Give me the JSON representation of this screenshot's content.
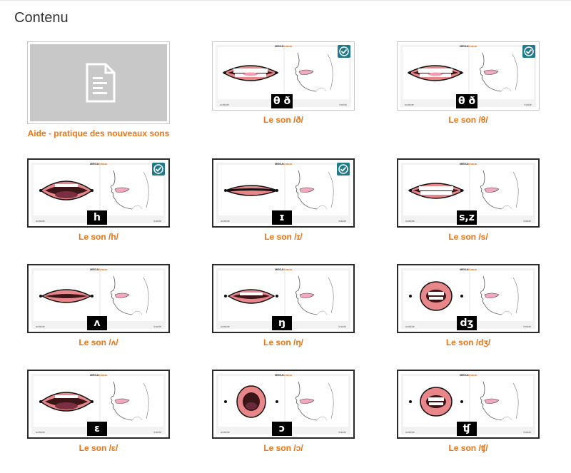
{
  "page": {
    "heading": "Contenu"
  },
  "brand": {
    "left": "MEGA",
    "right": "lingua"
  },
  "footer": {
    "outside": "outside",
    "inside": "inside"
  },
  "accent_color": "#f07213",
  "check_color": "#1e7a8c",
  "items": [
    {
      "label": "Aide - pratique des nouveaux sons",
      "type": "document",
      "icon": "document-icon",
      "completed": false
    },
    {
      "label": "Le son /ð/",
      "symbol": "θ ð",
      "completed": true,
      "mouth": "teeth-tongue"
    },
    {
      "label": "Le son /θ/",
      "symbol": "θ ð",
      "completed": true,
      "mouth": "teeth-tongue"
    },
    {
      "label": "Le son /h/",
      "symbol": "h",
      "completed": true,
      "mouth": "open"
    },
    {
      "label": "Le son /ɪ/",
      "symbol": "ɪ",
      "completed": true,
      "mouth": "closed"
    },
    {
      "label": "Le son /s/",
      "symbol": "s,z",
      "completed": false,
      "mouth": "teeth"
    },
    {
      "label": "Le son /ʌ/",
      "symbol": "ʌ",
      "completed": false,
      "mouth": "slit"
    },
    {
      "label": "Le son /ŋ/",
      "symbol": "ŋ",
      "completed": false,
      "mouth": "small-open"
    },
    {
      "label": "Le son /dʒ/",
      "symbol": "dʒ",
      "completed": false,
      "mouth": "round-teeth"
    },
    {
      "label": "Le son /ɛ/",
      "symbol": "ɛ",
      "completed": false,
      "mouth": "open"
    },
    {
      "label": "Le son /ɔ/",
      "symbol": "ɔ",
      "completed": false,
      "mouth": "round"
    },
    {
      "label": "Le son /ʧ/",
      "symbol": "ʧ",
      "completed": false,
      "mouth": "round-teeth"
    }
  ]
}
